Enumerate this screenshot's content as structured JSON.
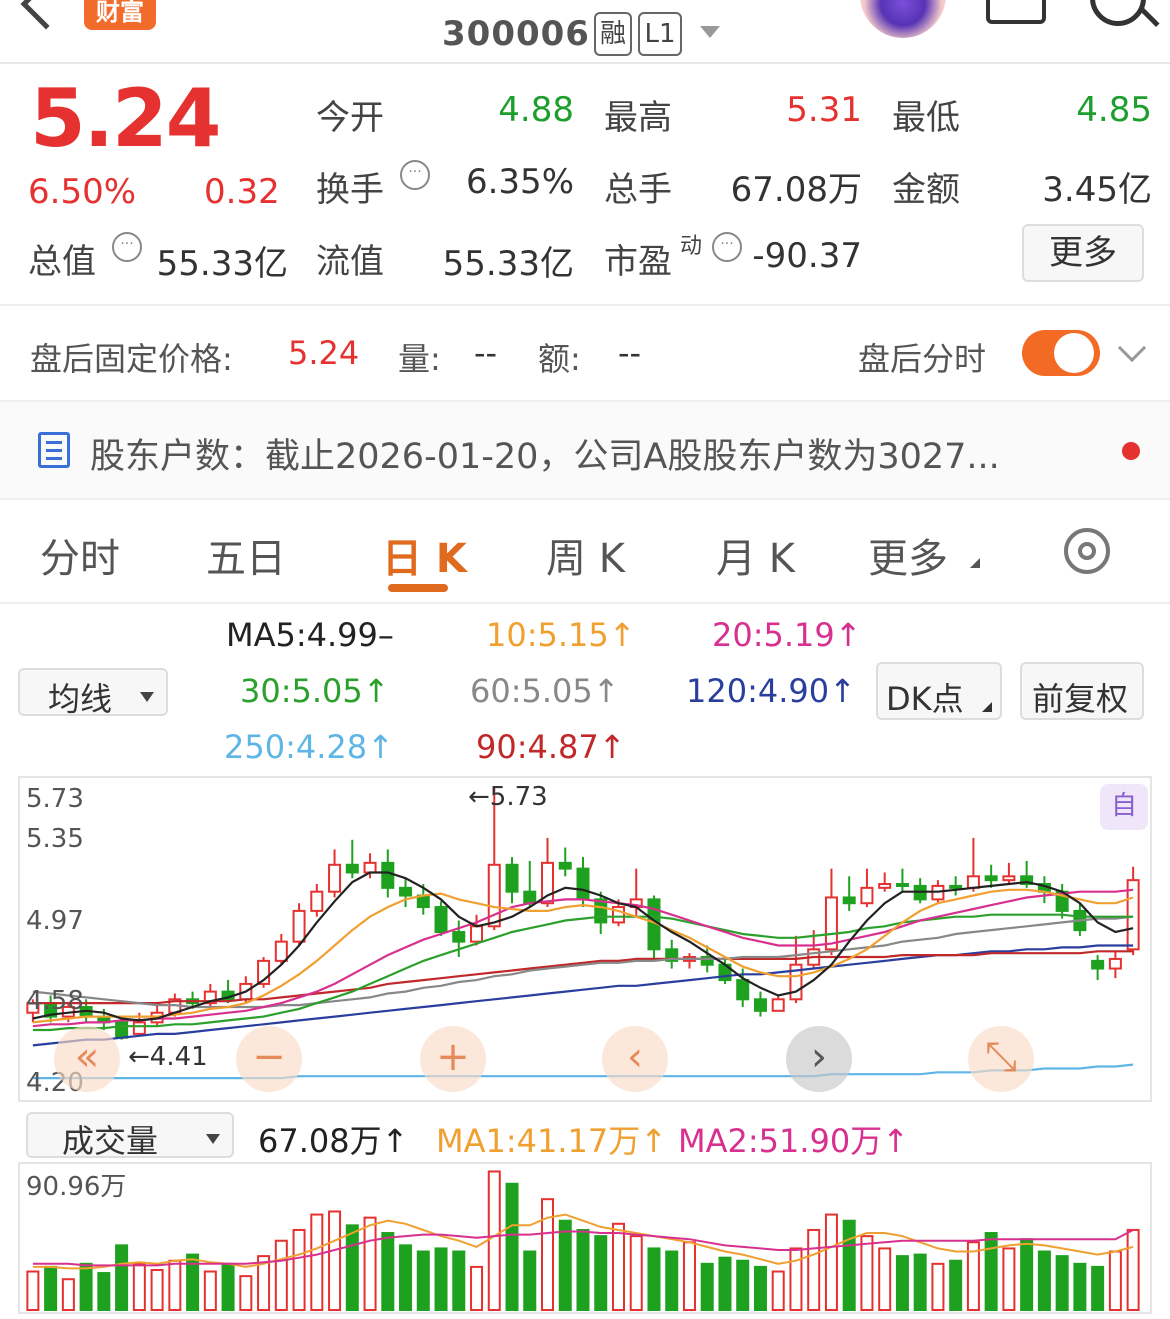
{
  "header": {
    "brand": "财富",
    "code": "300006",
    "tag_margin": "融",
    "tag_level": "L1"
  },
  "quote": {
    "price": "5.24",
    "change_pct": "6.50%",
    "change_amt": "0.32",
    "open_label": "今开",
    "open": "4.88",
    "high_label": "最高",
    "high": "5.31",
    "low_label": "最低",
    "low": "4.85",
    "turnover_label": "换手",
    "turnover": "6.35%",
    "volume_label": "总手",
    "volume": "67.08万",
    "amount_label": "金额",
    "amount": "3.45亿",
    "total_cap_label": "总值",
    "total_cap": "55.33亿",
    "float_cap_label": "流值",
    "float_cap": "55.33亿",
    "pe_label": "市盈",
    "pe_sup": "动",
    "pe": "-90.37",
    "more": "更多"
  },
  "after_hours": {
    "label": "盘后固定价格:",
    "price": "5.24",
    "vol_label": "量:",
    "vol": "--",
    "amt_label": "额:",
    "amt": "--",
    "toggle_label": "盘后分时"
  },
  "news": {
    "text": "股东户数：截止2026-01-20，公司A股股东户数为3027..."
  },
  "tabs": [
    "分时",
    "五日",
    "日 K",
    "周 K",
    "月 K",
    "更多"
  ],
  "ma_legend": {
    "dropdown": "均线",
    "ma5": "MA5:4.99–",
    "ma10": "10:5.15↑",
    "ma20": "20:5.19↑",
    "ma30": "30:5.05↑",
    "ma60": "60:5.05↑",
    "ma120": "120:4.90↑",
    "ma250": "250:4.28↑",
    "ma90": "90:4.87↑",
    "dk_button": "DK点",
    "adjust_button": "前复权",
    "colors": {
      "ma5": "#222222",
      "ma10": "#f0a030",
      "ma20": "#d8308f",
      "ma30": "#2ca02c",
      "ma60": "#888888",
      "ma120": "#2a3e9e",
      "ma250": "#5fb5e6",
      "ma90": "#c0282a"
    }
  },
  "kline": {
    "y_ticks": [
      "5.73",
      "5.35",
      "4.97",
      "4.58",
      "4.20"
    ],
    "max_label": "←5.73",
    "min_label": "←4.41",
    "self_badge": "自",
    "controls": [
      "«",
      "−",
      "+",
      "‹",
      "›",
      "⤡"
    ]
  },
  "volume": {
    "dropdown": "成交量",
    "current": "67.08万↑",
    "ma1": "MA1:41.17万↑",
    "ma2": "MA2:51.90万↑",
    "y_max": "90.96万"
  },
  "chart_data": {
    "type": "candlestick",
    "ylim": [
      4.2,
      5.73
    ],
    "candles": [
      [
        4.55,
        4.6,
        4.62,
        4.5
      ],
      [
        4.6,
        4.53,
        4.64,
        4.5
      ],
      [
        4.53,
        4.58,
        4.6,
        4.5
      ],
      [
        4.58,
        4.53,
        4.62,
        4.5
      ],
      [
        4.53,
        4.5,
        4.57,
        4.46
      ],
      [
        4.5,
        4.42,
        4.52,
        4.41
      ],
      [
        4.44,
        4.5,
        4.55,
        4.43
      ],
      [
        4.5,
        4.55,
        4.6,
        4.48
      ],
      [
        4.55,
        4.62,
        4.65,
        4.53
      ],
      [
        4.62,
        4.6,
        4.66,
        4.57
      ],
      [
        4.6,
        4.66,
        4.7,
        4.58
      ],
      [
        4.66,
        4.62,
        4.72,
        4.6
      ],
      [
        4.62,
        4.7,
        4.74,
        4.6
      ],
      [
        4.7,
        4.82,
        4.84,
        4.68
      ],
      [
        4.82,
        4.92,
        4.96,
        4.8
      ],
      [
        4.92,
        5.08,
        5.12,
        4.9
      ],
      [
        5.08,
        5.18,
        5.22,
        5.05
      ],
      [
        5.18,
        5.32,
        5.4,
        5.15
      ],
      [
        5.32,
        5.28,
        5.45,
        5.25
      ],
      [
        5.28,
        5.33,
        5.38,
        5.25
      ],
      [
        5.33,
        5.2,
        5.4,
        5.15
      ],
      [
        5.2,
        5.16,
        5.25,
        5.1
      ],
      [
        5.16,
        5.1,
        5.22,
        5.06
      ],
      [
        5.1,
        4.97,
        5.13,
        4.95
      ],
      [
        4.97,
        4.92,
        5.03,
        4.84
      ],
      [
        4.92,
        5.0,
        5.06,
        4.9
      ],
      [
        5.0,
        5.32,
        5.73,
        4.98
      ],
      [
        5.32,
        5.18,
        5.36,
        5.12
      ],
      [
        5.18,
        5.12,
        5.34,
        5.1
      ],
      [
        5.12,
        5.33,
        5.46,
        5.1
      ],
      [
        5.33,
        5.3,
        5.41,
        5.26
      ],
      [
        5.3,
        5.14,
        5.36,
        5.1
      ],
      [
        5.14,
        5.02,
        5.18,
        4.96
      ],
      [
        5.02,
        5.1,
        5.14,
        5.0
      ],
      [
        5.1,
        5.14,
        5.3,
        5.05
      ],
      [
        5.14,
        4.88,
        5.16,
        4.82
      ],
      [
        4.88,
        4.82,
        4.93,
        4.78
      ],
      [
        4.82,
        4.84,
        4.86,
        4.78
      ],
      [
        4.84,
        4.8,
        4.9,
        4.76
      ],
      [
        4.8,
        4.72,
        4.84,
        4.7
      ],
      [
        4.72,
        4.62,
        4.78,
        4.58
      ],
      [
        4.62,
        4.56,
        4.66,
        4.53
      ],
      [
        4.56,
        4.62,
        4.64,
        4.56
      ],
      [
        4.62,
        4.8,
        4.95,
        4.6
      ],
      [
        4.8,
        4.88,
        4.98,
        4.78
      ],
      [
        4.88,
        5.15,
        5.3,
        4.85
      ],
      [
        5.15,
        5.12,
        5.26,
        5.08
      ],
      [
        5.12,
        5.2,
        5.3,
        5.1
      ],
      [
        5.2,
        5.22,
        5.28,
        5.18
      ],
      [
        5.22,
        5.21,
        5.3,
        5.18
      ],
      [
        5.21,
        5.14,
        5.25,
        5.12
      ],
      [
        5.14,
        5.21,
        5.24,
        5.12
      ],
      [
        5.21,
        5.2,
        5.26,
        5.16
      ],
      [
        5.2,
        5.26,
        5.46,
        5.18
      ],
      [
        5.26,
        5.24,
        5.32,
        5.2
      ],
      [
        5.24,
        5.26,
        5.33,
        5.22
      ],
      [
        5.26,
        5.22,
        5.34,
        5.2
      ],
      [
        5.22,
        5.18,
        5.26,
        5.12
      ],
      [
        5.18,
        5.08,
        5.22,
        5.04
      ],
      [
        5.08,
        4.98,
        5.12,
        4.95
      ],
      [
        4.82,
        4.78,
        4.85,
        4.72
      ],
      [
        4.78,
        4.83,
        4.87,
        4.73
      ],
      [
        4.88,
        5.24,
        5.31,
        4.85
      ]
    ],
    "ma5": [
      4.52,
      4.54,
      4.55,
      4.56,
      4.55,
      4.52,
      4.51,
      4.52,
      4.55,
      4.58,
      4.61,
      4.63,
      4.66,
      4.72,
      4.8,
      4.9,
      5.02,
      5.13,
      5.23,
      5.28,
      5.28,
      5.25,
      5.2,
      5.14,
      5.05,
      5.0,
      5.02,
      5.05,
      5.1,
      5.16,
      5.2,
      5.19,
      5.16,
      5.12,
      5.1,
      5.03,
      4.97,
      4.92,
      4.86,
      4.8,
      4.73,
      4.68,
      4.64,
      4.66,
      4.72,
      4.8,
      4.92,
      5.03,
      5.12,
      5.18,
      5.18,
      5.18,
      5.19,
      5.2,
      5.21,
      5.22,
      5.23,
      5.21,
      5.18,
      5.12,
      5.02,
      4.97,
      4.99
    ],
    "ma10": [
      4.5,
      4.51,
      4.52,
      4.53,
      4.53,
      4.53,
      4.53,
      4.53,
      4.54,
      4.55,
      4.57,
      4.58,
      4.6,
      4.64,
      4.69,
      4.75,
      4.82,
      4.9,
      4.98,
      5.05,
      5.1,
      5.14,
      5.16,
      5.17,
      5.14,
      5.12,
      5.1,
      5.09,
      5.08,
      5.08,
      5.1,
      5.11,
      5.1,
      5.08,
      5.05,
      5.02,
      4.98,
      4.94,
      4.89,
      4.84,
      4.79,
      4.76,
      4.74,
      4.74,
      4.76,
      4.79,
      4.83,
      4.88,
      4.95,
      5.02,
      5.08,
      5.12,
      5.14,
      5.16,
      5.18,
      5.19,
      5.19,
      5.18,
      5.16,
      5.14,
      5.12,
      5.12,
      5.15
    ],
    "ma20": [
      4.48,
      4.49,
      4.49,
      4.5,
      4.5,
      4.51,
      4.51,
      4.52,
      4.52,
      4.53,
      4.54,
      4.55,
      4.56,
      4.58,
      4.6,
      4.63,
      4.66,
      4.7,
      4.75,
      4.8,
      4.85,
      4.89,
      4.93,
      4.96,
      4.99,
      5.02,
      5.06,
      5.1,
      5.12,
      5.13,
      5.14,
      5.14,
      5.13,
      5.12,
      5.11,
      5.09,
      5.06,
      5.03,
      5.0,
      4.97,
      4.94,
      4.92,
      4.9,
      4.9,
      4.9,
      4.91,
      4.93,
      4.95,
      4.97,
      5.0,
      5.03,
      5.05,
      5.07,
      5.09,
      5.11,
      5.13,
      5.15,
      5.16,
      5.17,
      5.18,
      5.18,
      5.18,
      5.19
    ],
    "ma30": [
      4.46,
      4.46,
      4.47,
      4.47,
      4.47,
      4.48,
      4.48,
      4.48,
      4.49,
      4.49,
      4.5,
      4.51,
      4.52,
      4.53,
      4.55,
      4.57,
      4.6,
      4.63,
      4.66,
      4.7,
      4.74,
      4.78,
      4.82,
      4.85,
      4.88,
      4.91,
      4.94,
      4.97,
      4.99,
      5.01,
      5.03,
      5.04,
      5.05,
      5.05,
      5.05,
      5.05,
      5.04,
      5.02,
      5.0,
      4.98,
      4.96,
      4.95,
      4.94,
      4.94,
      4.95,
      4.96,
      4.97,
      4.99,
      5.0,
      5.02,
      5.03,
      5.04,
      5.05,
      5.05,
      5.06,
      5.06,
      5.06,
      5.06,
      5.06,
      5.05,
      5.05,
      5.05,
      5.05
    ],
    "ma60": [
      4.66,
      4.65,
      4.64,
      4.63,
      4.62,
      4.61,
      4.6,
      4.59,
      4.59,
      4.58,
      4.58,
      4.58,
      4.58,
      4.58,
      4.59,
      4.59,
      4.6,
      4.61,
      4.62,
      4.63,
      4.65,
      4.66,
      4.68,
      4.69,
      4.71,
      4.72,
      4.74,
      4.75,
      4.77,
      4.78,
      4.79,
      4.8,
      4.81,
      4.81,
      4.82,
      4.82,
      4.83,
      4.83,
      4.83,
      4.83,
      4.84,
      4.84,
      4.84,
      4.85,
      4.86,
      4.87,
      4.88,
      4.89,
      4.9,
      4.92,
      4.93,
      4.94,
      4.96,
      4.97,
      4.98,
      4.99,
      5.0,
      5.01,
      5.02,
      5.03,
      5.04,
      5.04,
      5.05
    ],
    "ma90": [
      4.6,
      4.6,
      4.6,
      4.6,
      4.6,
      4.6,
      4.6,
      4.6,
      4.61,
      4.61,
      4.61,
      4.61,
      4.62,
      4.62,
      4.63,
      4.64,
      4.65,
      4.66,
      4.67,
      4.68,
      4.7,
      4.71,
      4.72,
      4.73,
      4.74,
      4.75,
      4.76,
      4.77,
      4.78,
      4.79,
      4.8,
      4.81,
      4.82,
      4.82,
      4.83,
      4.83,
      4.83,
      4.83,
      4.83,
      4.83,
      4.83,
      4.83,
      4.83,
      4.83,
      4.84,
      4.84,
      4.84,
      4.84,
      4.84,
      4.85,
      4.85,
      4.85,
      4.85,
      4.85,
      4.86,
      4.86,
      4.86,
      4.86,
      4.86,
      4.86,
      4.87,
      4.87,
      4.87
    ],
    "ma120": [
      4.38,
      4.39,
      4.4,
      4.41,
      4.41,
      4.42,
      4.43,
      4.44,
      4.44,
      4.45,
      4.46,
      4.47,
      4.48,
      4.49,
      4.5,
      4.51,
      4.52,
      4.53,
      4.54,
      4.55,
      4.56,
      4.57,
      4.58,
      4.59,
      4.6,
      4.61,
      4.62,
      4.63,
      4.64,
      4.65,
      4.66,
      4.67,
      4.68,
      4.69,
      4.69,
      4.7,
      4.71,
      4.72,
      4.73,
      4.74,
      4.75,
      4.75,
      4.76,
      4.77,
      4.78,
      4.79,
      4.8,
      4.81,
      4.82,
      4.83,
      4.84,
      4.85,
      4.85,
      4.86,
      4.87,
      4.87,
      4.88,
      4.88,
      4.89,
      4.89,
      4.9,
      4.9,
      4.9
    ],
    "ma250": [
      4.21,
      4.21,
      4.21,
      4.21,
      4.21,
      4.21,
      4.21,
      4.21,
      4.21,
      4.21,
      4.21,
      4.21,
      4.21,
      4.21,
      4.21,
      4.22,
      4.22,
      4.22,
      4.22,
      4.22,
      4.22,
      4.22,
      4.22,
      4.22,
      4.22,
      4.22,
      4.22,
      4.22,
      4.22,
      4.22,
      4.22,
      4.22,
      4.22,
      4.22,
      4.22,
      4.22,
      4.22,
      4.22,
      4.22,
      4.22,
      4.22,
      4.22,
      4.22,
      4.22,
      4.22,
      4.23,
      4.23,
      4.23,
      4.23,
      4.23,
      4.23,
      4.24,
      4.24,
      4.24,
      4.25,
      4.25,
      4.25,
      4.26,
      4.26,
      4.26,
      4.27,
      4.27,
      4.28
    ],
    "volume": [
      25,
      28,
      20,
      30,
      24,
      42,
      30,
      26,
      32,
      36,
      25,
      30,
      22,
      35,
      45,
      52,
      62,
      64,
      55,
      60,
      50,
      42,
      38,
      40,
      38,
      28,
      90,
      82,
      38,
      72,
      58,
      52,
      48,
      56,
      48,
      40,
      38,
      44,
      30,
      34,
      32,
      28,
      25,
      40,
      52,
      62,
      58,
      48,
      40,
      35,
      36,
      30,
      32,
      44,
      50,
      40,
      46,
      38,
      35,
      30,
      28,
      38,
      52
    ],
    "volume_ma1": [
      28,
      28,
      27,
      27,
      28,
      30,
      31,
      30,
      32,
      33,
      31,
      30,
      28,
      30,
      33,
      36,
      40,
      45,
      50,
      55,
      58,
      56,
      52,
      48,
      45,
      41,
      48,
      55,
      55,
      60,
      62,
      58,
      54,
      52,
      50,
      48,
      46,
      44,
      41,
      38,
      36,
      33,
      30,
      32,
      36,
      41,
      46,
      50,
      50,
      48,
      44,
      40,
      38,
      38,
      40,
      42,
      43,
      42,
      40,
      38,
      36,
      38,
      41
    ],
    "volume_ma2": [
      30,
      30,
      30,
      29,
      29,
      29,
      29,
      29,
      30,
      30,
      30,
      30,
      30,
      31,
      32,
      34,
      36,
      39,
      42,
      45,
      47,
      48,
      49,
      49,
      48,
      47,
      48,
      49,
      49,
      50,
      51,
      51,
      50,
      50,
      49,
      48,
      47,
      46,
      44,
      42,
      41,
      40,
      39,
      39,
      40,
      41,
      42,
      43,
      44,
      45,
      45,
      45,
      45,
      45,
      46,
      46,
      46,
      46,
      46,
      46,
      46,
      46,
      52
    ]
  }
}
